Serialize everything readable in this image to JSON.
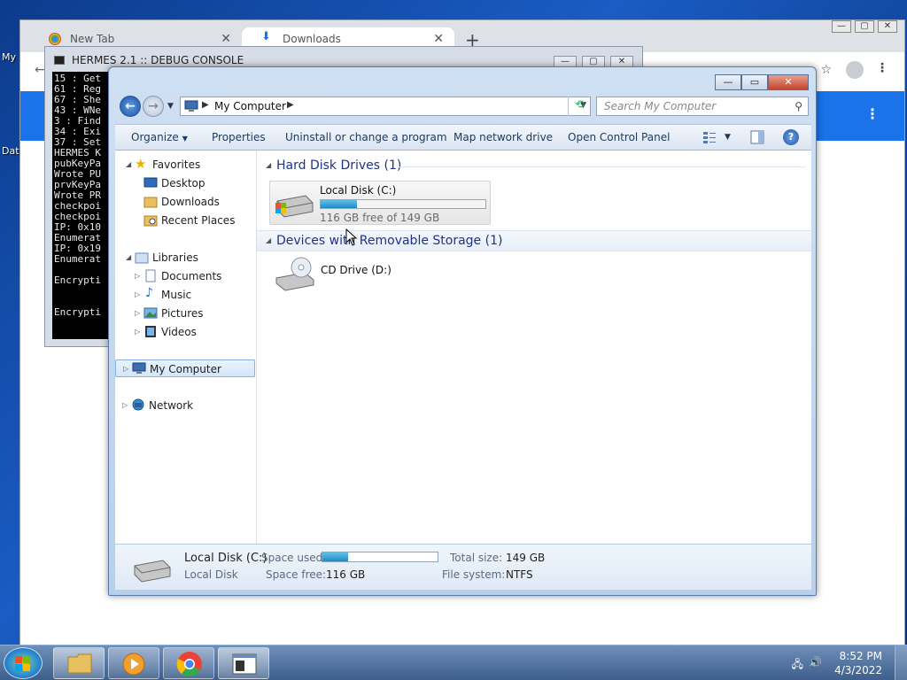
{
  "desktop": {
    "icon_labels": [
      "My",
      "Dat"
    ]
  },
  "chrome": {
    "tabs": [
      {
        "label": "New Tab"
      },
      {
        "label": "Downloads"
      }
    ],
    "newtab": "+",
    "controls": {
      "min": "—",
      "max": "▢",
      "close": "✕"
    }
  },
  "console": {
    "title": "HERMES 2.1 :: DEBUG CONSOLE",
    "lines": [
      "15 : Get",
      "61 : Reg",
      "67 : She",
      "43 : WNe",
      "3 : Find",
      "34 : Exi",
      "37 : Set",
      "HERMES K",
      "pubKeyPa",
      "Wrote PU",
      "prvKeyPa",
      "Wrote PR",
      "checkpoi",
      "checkpoi",
      "IP: 0x10",
      "Enumerat",
      "IP: 0x19",
      "Enumerat",
      "",
      "Encrypti",
      "",
      "",
      "Encrypti"
    ]
  },
  "explorer": {
    "controls": {
      "min": "—",
      "max": "▭",
      "close": "✕"
    },
    "address": {
      "crumb": "My Computer"
    },
    "search": {
      "placeholder": "Search My Computer"
    },
    "commands": {
      "organize": "Organize",
      "properties": "Properties",
      "uninstall": "Uninstall or change a program",
      "map_drive": "Map network drive",
      "control_panel": "Open Control Panel",
      "help": "?"
    },
    "nav": {
      "favorites": "Favorites",
      "desktop": "Desktop",
      "downloads": "Downloads",
      "recent": "Recent Places",
      "libraries": "Libraries",
      "documents": "Documents",
      "music": "Music",
      "pictures": "Pictures",
      "videos": "Videos",
      "my_computer": "My Computer",
      "network": "Network"
    },
    "groups": {
      "hdd": "Hard Disk Drives (1)",
      "removable": "Devices with Removable Storage (1)"
    },
    "drive_c": {
      "name": "Local Disk (C:)",
      "free": "116 GB free of 149 GB",
      "used_fraction": 0.22
    },
    "drive_d": {
      "name": "CD Drive (D:)"
    },
    "details": {
      "name": "Local Disk (C:)",
      "type": "Local Disk",
      "space_used_label": "Space used:",
      "space_free_label": "Space free:",
      "space_free": "116 GB",
      "total_size_label": "Total size:",
      "total_size": "149 GB",
      "fs_label": "File system:",
      "fs": "NTFS",
      "used_fraction": 0.22
    }
  },
  "taskbar": {
    "time": "8:52 PM",
    "date": "4/3/2022"
  }
}
